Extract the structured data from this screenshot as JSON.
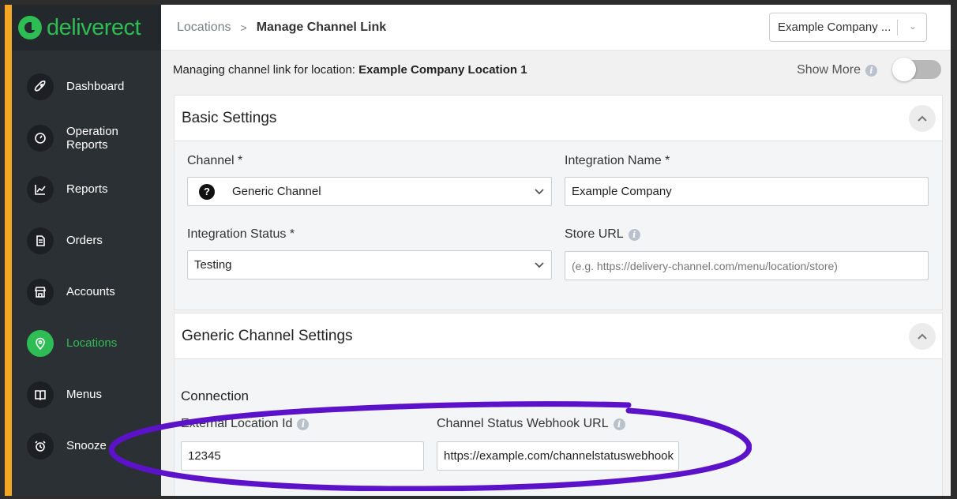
{
  "app": {
    "brand": "deliverect",
    "brand_color": "#2ebd54"
  },
  "sidebar": {
    "items": [
      {
        "label": "Dashboard",
        "icon": "rocket-icon",
        "active": false
      },
      {
        "label": "Operation Reports",
        "icon": "gauge-icon",
        "active": false
      },
      {
        "label": "Reports",
        "icon": "chart-icon",
        "active": false
      },
      {
        "label": "Orders",
        "icon": "document-icon",
        "active": false
      },
      {
        "label": "Accounts",
        "icon": "store-icon",
        "active": false
      },
      {
        "label": "Locations",
        "icon": "location-pin-icon",
        "active": true
      },
      {
        "label": "Menus",
        "icon": "book-icon",
        "active": false
      },
      {
        "label": "Snooze",
        "icon": "alarm-clock-icon",
        "active": false
      }
    ]
  },
  "header": {
    "breadcrumb_root": "Locations",
    "breadcrumb_current": "Manage Channel Link",
    "company_select": "Example Company ..."
  },
  "manage": {
    "prefix": "Managing channel link for location:",
    "location": "Example Company Location 1",
    "show_more": "Show More",
    "show_more_enabled": false
  },
  "basic_settings": {
    "title": "Basic Settings",
    "channel_label": "Channel *",
    "channel_value": "Generic Channel",
    "integration_name_label": "Integration Name *",
    "integration_name_value": "Example Company",
    "integration_status_label": "Integration Status *",
    "integration_status_value": "Testing",
    "store_url_label": "Store URL",
    "store_url_placeholder": "(e.g. https://delivery-channel.com/menu/location/store)"
  },
  "generic_settings": {
    "title": "Generic Channel Settings",
    "connection_heading": "Connection",
    "external_location_label": "External Location Id",
    "external_location_value": "12345",
    "webhook_label": "Channel Status Webhook URL",
    "webhook_value": "https://example.com/channelstatuswebhook"
  },
  "annotation": {
    "color": "#5b12c9"
  }
}
